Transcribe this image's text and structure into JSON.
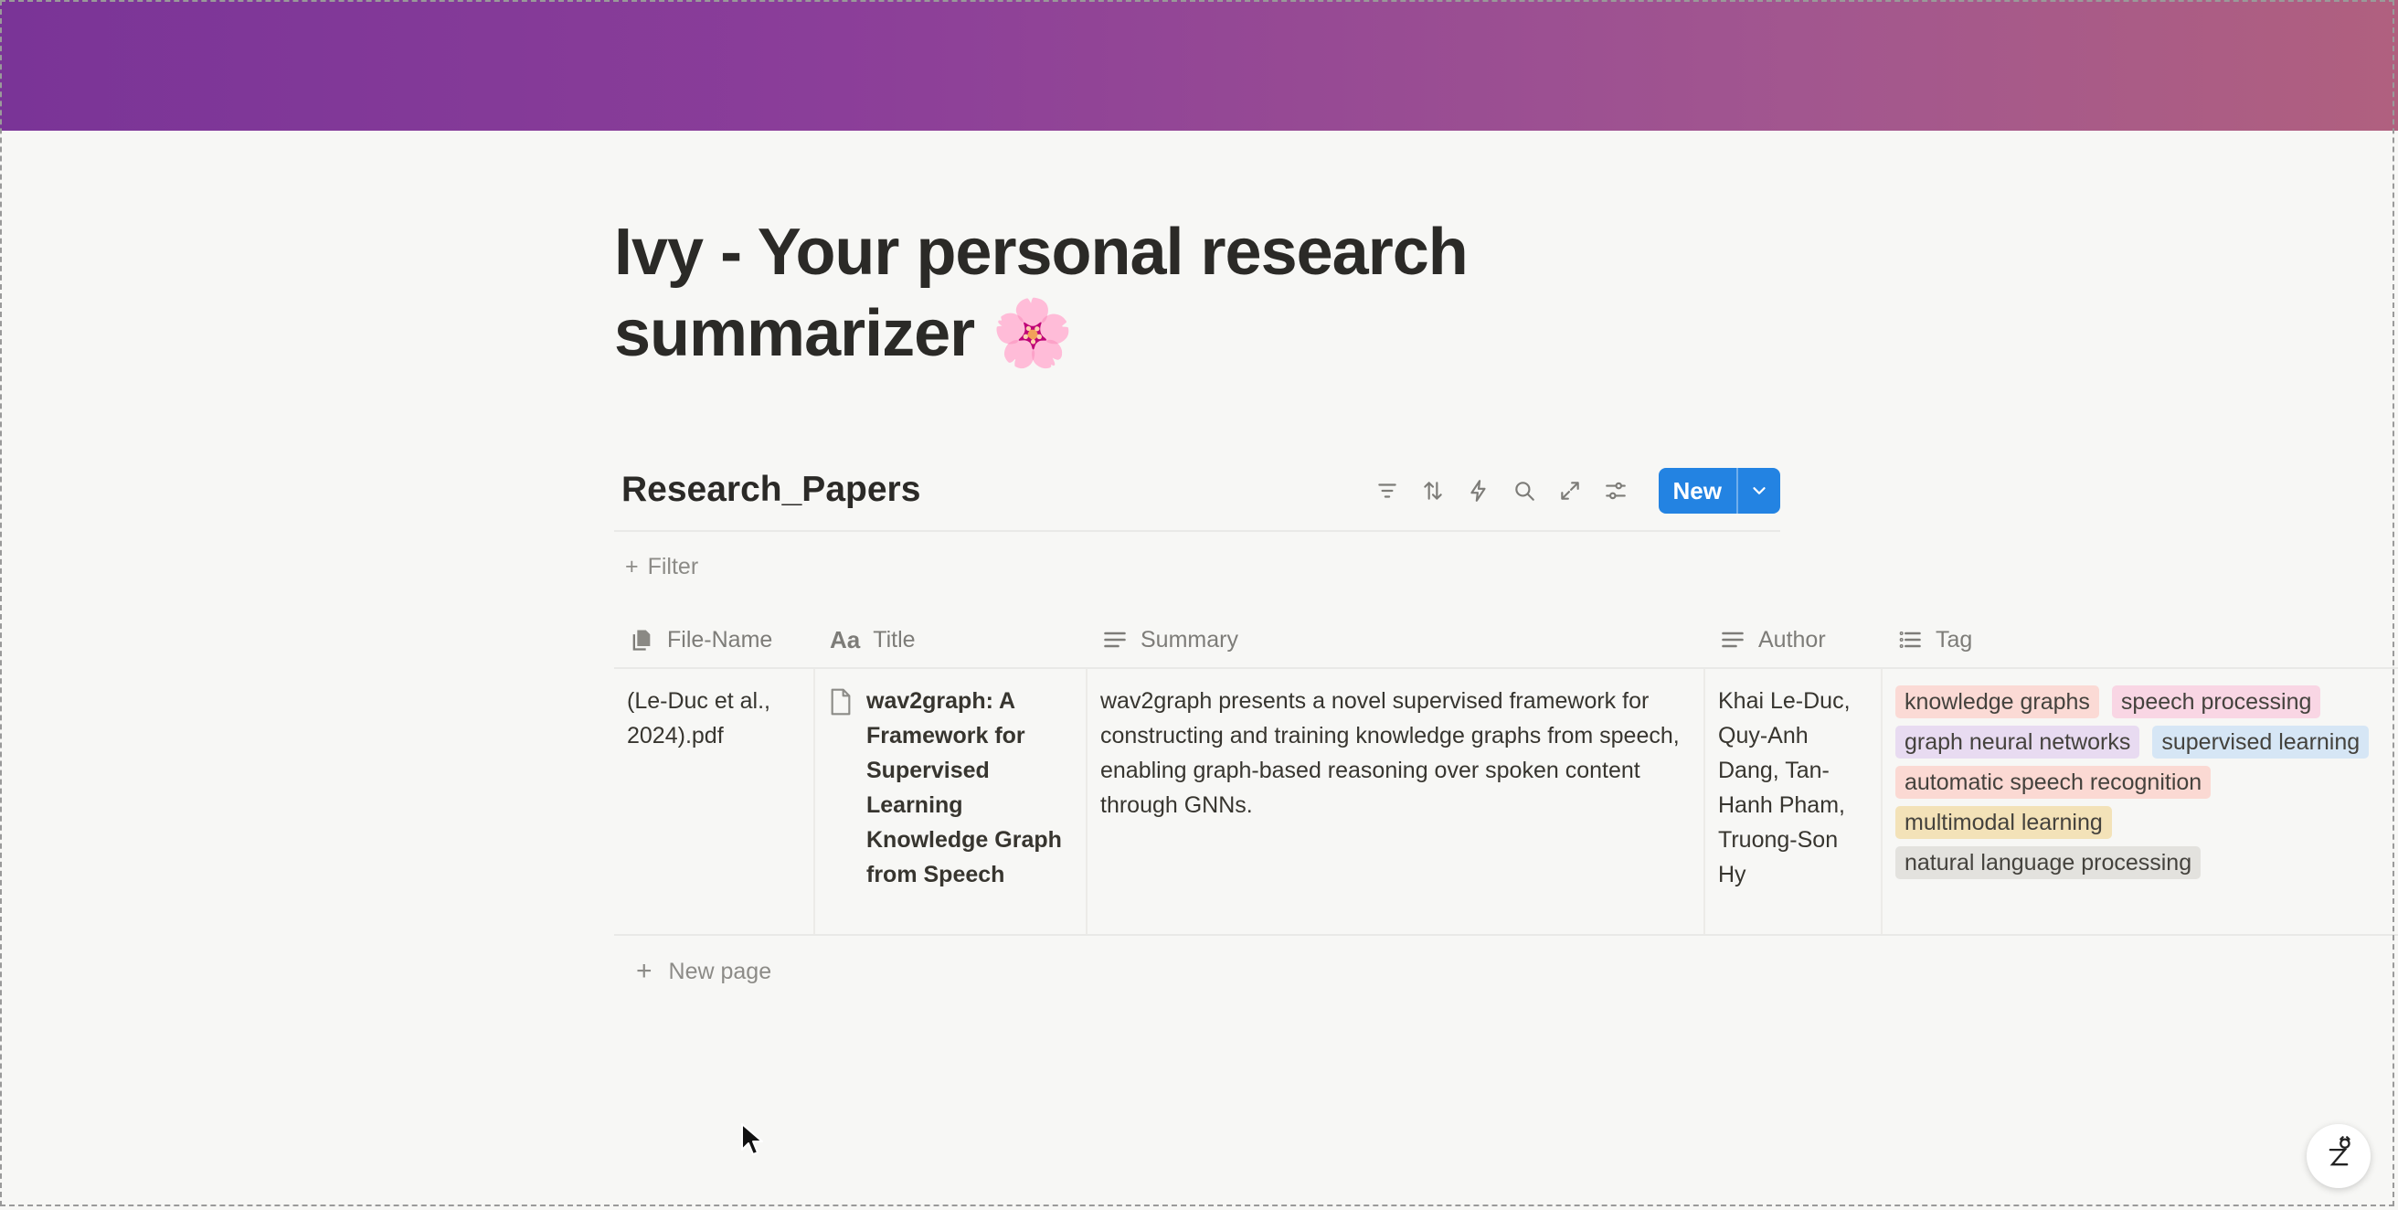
{
  "banner": {
    "gradient_start": "#7a3497",
    "gradient_end": "#b0607f"
  },
  "page": {
    "title": "Ivy - Your personal research summarizer",
    "title_emoji": "🌸"
  },
  "database": {
    "name": "Research_Papers",
    "toolbar": {
      "icons": [
        "filter-icon",
        "sort-icon",
        "automation-icon",
        "search-icon",
        "expand-icon",
        "settings-icon"
      ],
      "new_button_label": "New",
      "accent": "#2383e2"
    },
    "filter_label": "Filter",
    "columns": [
      {
        "label": "File-Name",
        "icon": "files-icon"
      },
      {
        "label": "Title",
        "icon": "title-text-icon"
      },
      {
        "label": "Summary",
        "icon": "text-lines-icon"
      },
      {
        "label": "Author",
        "icon": "text-lines-icon"
      },
      {
        "label": "Tag",
        "icon": "list-icon"
      }
    ],
    "rows": [
      {
        "file_name": "(Le-Duc et al., 2024).pdf",
        "title": "wav2graph: A Framework for Supervised Learning Knowledge Graph from Speech",
        "summary": "wav2graph presents a novel supervised framework for constructing and training knowledge graphs from speech, enabling graph-based reasoning over spoken content through GNNs.",
        "author": "Khai Le-Duc, Quy-Anh Dang, Tan-Hanh Pham, Truong-Son Hy",
        "tags": [
          {
            "label": "knowledge graphs",
            "color": "#fbdad5"
          },
          {
            "label": "speech processing",
            "color": "#f9d6e4"
          },
          {
            "label": "graph neural networks",
            "color": "#e8dbf1"
          },
          {
            "label": "supervised learning",
            "color": "#d6e6f5"
          },
          {
            "label": "automatic speech recognition",
            "color": "#fbd9d3"
          },
          {
            "label": "multimodal learning",
            "color": "#f3e2b8"
          },
          {
            "label": "natural language processing",
            "color": "#e3e2de"
          }
        ]
      }
    ],
    "new_page_label": "New page"
  }
}
